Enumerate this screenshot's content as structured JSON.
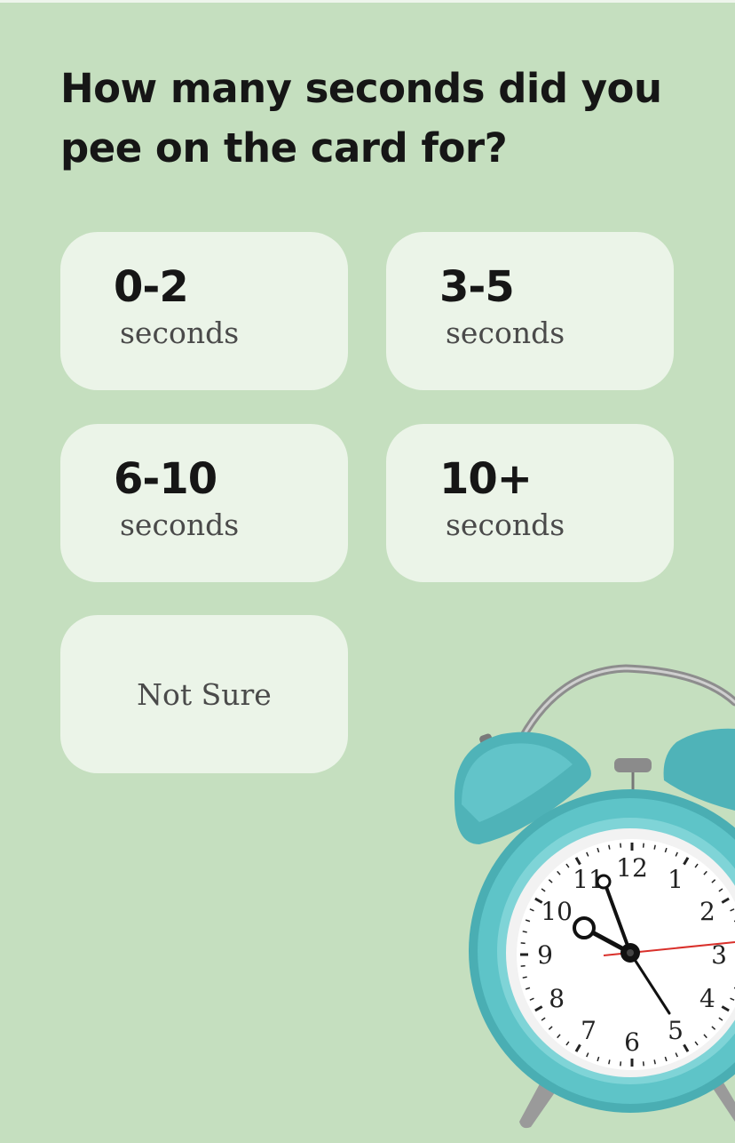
{
  "question": "How many seconds did you pee on the card for?",
  "options": [
    {
      "value": "0-2",
      "unit": "seconds"
    },
    {
      "value": "3-5",
      "unit": "seconds"
    },
    {
      "value": "6-10",
      "unit": "seconds"
    },
    {
      "value": "10+",
      "unit": "seconds"
    }
  ],
  "not_sure": "Not Sure",
  "clock": {
    "numerals": [
      "12",
      "1",
      "2",
      "3",
      "4",
      "5",
      "6",
      "7",
      "8",
      "9",
      "10",
      "11"
    ],
    "body_color": "#5ec4c8",
    "second_hand_color": "#d9302b"
  }
}
